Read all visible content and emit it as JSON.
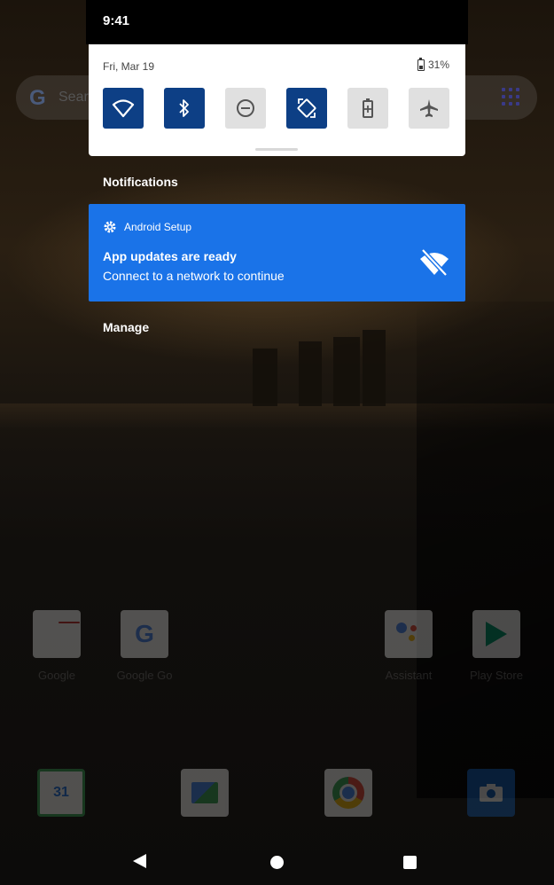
{
  "status_bar": {
    "time": "9:41"
  },
  "home_screen": {
    "search_hint": "Sear",
    "apps": [
      {
        "name": "google-folder",
        "label": "Google"
      },
      {
        "name": "google-go",
        "label": "Google Go"
      },
      {
        "name": "assistant",
        "label": "Assistant"
      },
      {
        "name": "play-store",
        "label": "Play Store"
      }
    ],
    "dock": [
      {
        "name": "calendar",
        "text": "31"
      },
      {
        "name": "files"
      },
      {
        "name": "chrome"
      },
      {
        "name": "camera"
      }
    ]
  },
  "quick_settings": {
    "date": "Fri, Mar 19",
    "battery": "31%",
    "tiles": [
      {
        "name": "wifi",
        "icon": "wifi-icon",
        "state": "on"
      },
      {
        "name": "bluetooth",
        "icon": "bluetooth-icon",
        "state": "on"
      },
      {
        "name": "do-not-disturb",
        "icon": "dnd-icon",
        "state": "off"
      },
      {
        "name": "auto-rotate",
        "icon": "rotate-icon",
        "state": "on"
      },
      {
        "name": "battery-saver",
        "icon": "battery-saver-icon",
        "state": "off"
      },
      {
        "name": "airplane-mode",
        "icon": "airplane-icon",
        "state": "off"
      }
    ],
    "colors": {
      "tile_on": "#0d3f85",
      "tile_off": "#e0e0e0"
    }
  },
  "notifications": {
    "header": "Notifications",
    "items": [
      {
        "app": "Android Setup",
        "title": "App updates are ready",
        "body": "Connect to a network to continue",
        "color": "#1a73e8"
      }
    ],
    "manage_label": "Manage"
  }
}
